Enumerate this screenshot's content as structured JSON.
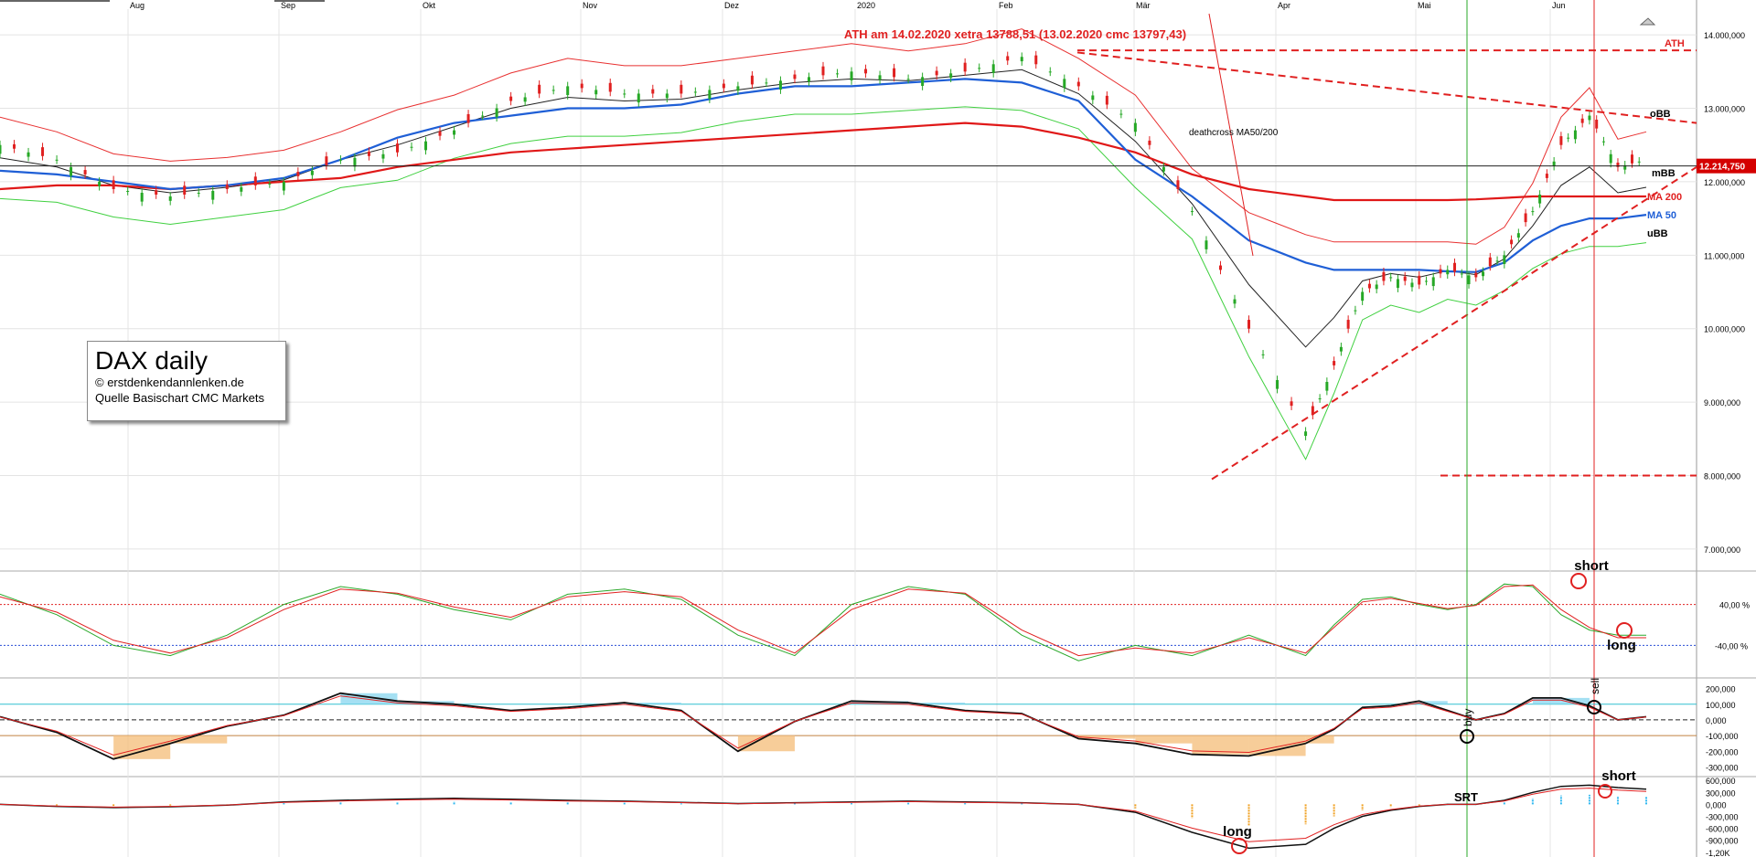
{
  "chart_data": {
    "type": "line",
    "title": "ATH am 14.02.2020 xetra 13788,51 (13.02.2020  cmc 13797,43)",
    "months": [
      "Aug",
      "Sep",
      "Okt",
      "Nov",
      "Dez",
      "2020",
      "Feb",
      "Mär",
      "Apr",
      "Mai",
      "Jun"
    ],
    "y_ticks": [
      "14.000,000",
      "13.000,000",
      "12.000,000",
      "11.000,000",
      "10.000,000",
      "9.000,000",
      "8.000,000",
      "7.000,000"
    ],
    "ylim": [
      6700,
      14350
    ],
    "current_price": "12.214,750",
    "price_x": [
      0,
      10,
      20,
      30,
      40,
      50,
      60,
      70,
      80,
      90,
      100,
      110,
      120,
      130,
      140,
      150,
      160,
      170,
      180,
      190,
      200,
      210,
      220,
      230,
      235,
      240,
      245,
      250,
      255,
      260,
      265,
      270,
      275,
      280,
      285,
      290
    ],
    "close": [
      12500,
      12300,
      11900,
      11800,
      11900,
      12000,
      12300,
      12400,
      12700,
      13100,
      13300,
      13200,
      13200,
      13300,
      13400,
      13500,
      13400,
      13500,
      13700,
      13300,
      12800,
      11600,
      10000,
      8600,
      9500,
      10500,
      10700,
      10600,
      10800,
      10700,
      11000,
      11600,
      12500,
      12900,
      12200,
      12300
    ],
    "ma50": [
      12150,
      12100,
      12000,
      11900,
      11950,
      12050,
      12300,
      12600,
      12800,
      12900,
      13000,
      13000,
      13050,
      13200,
      13300,
      13300,
      13350,
      13400,
      13350,
      13100,
      12300,
      11800,
      11200,
      10900,
      10800,
      10800,
      10800,
      10800,
      10780,
      10770,
      10900,
      11200,
      11400,
      11500,
      11500,
      11550
    ],
    "ma200": [
      11900,
      11950,
      11950,
      11900,
      11950,
      12000,
      12050,
      12200,
      12300,
      12400,
      12450,
      12500,
      12550,
      12600,
      12650,
      12700,
      12750,
      12800,
      12750,
      12600,
      12400,
      12100,
      11900,
      11800,
      11750,
      11750,
      11750,
      11750,
      11750,
      11760,
      11780,
      11800,
      11800,
      11800,
      11800,
      11800
    ],
    "ath_level": 13788.51,
    "low_level": 8000,
    "labels": {
      "ath": "ATH",
      "obb": "oBB",
      "mbb": "mBB",
      "ma200": "MA 200",
      "ma50": "MA 50",
      "ubb": "uBB",
      "deathcross": "deathcross MA50/200"
    },
    "stoch": {
      "ticks": [
        "40,00 %",
        "-40,00 %"
      ],
      "k": [
        60,
        20,
        -40,
        -60,
        -20,
        40,
        75,
        60,
        30,
        10,
        60,
        70,
        50,
        -20,
        -60,
        40,
        75,
        60,
        -20,
        -70,
        -40,
        -60,
        -20,
        -60,
        0,
        50,
        55,
        40,
        30,
        40,
        80,
        75,
        20,
        -10,
        -20,
        -20
      ],
      "d": [
        55,
        25,
        -30,
        -55,
        -25,
        30,
        70,
        62,
        35,
        15,
        55,
        65,
        55,
        -10,
        -55,
        30,
        70,
        62,
        -10,
        -60,
        -45,
        -55,
        -25,
        -55,
        -5,
        45,
        52,
        42,
        32,
        38,
        75,
        78,
        30,
        -5,
        -25,
        -25
      ]
    },
    "macd": {
      "ticks": [
        "200,000",
        "100,000",
        "0,000",
        "-100,000",
        "-200,000",
        "-300,000"
      ],
      "line": [
        20,
        -80,
        -250,
        -150,
        -40,
        30,
        170,
        120,
        100,
        60,
        80,
        110,
        60,
        -200,
        -10,
        120,
        110,
        60,
        40,
        -120,
        -150,
        -220,
        -230,
        -150,
        -60,
        80,
        90,
        120,
        60,
        0,
        40,
        140,
        140,
        90,
        0,
        20
      ]
    },
    "srt": {
      "ticks": [
        "600,000",
        "300,000",
        "0,000",
        "-300,000",
        "-600,000",
        "-900,000",
        "-1,20K"
      ],
      "line": [
        0,
        -50,
        -80,
        -60,
        -20,
        60,
        100,
        130,
        150,
        130,
        100,
        80,
        50,
        20,
        40,
        60,
        80,
        60,
        40,
        0,
        -200,
        -700,
        -1100,
        -1000,
        -600,
        -300,
        -150,
        -50,
        0,
        0,
        100,
        300,
        450,
        480,
        420,
        380
      ]
    },
    "annotations": {
      "short_top": "short",
      "long_mid": "long",
      "buy": "buy",
      "sell": "sell",
      "long_bottom": "long",
      "srt": "SRT",
      "short_bottom": "short"
    }
  },
  "legend": {
    "title": "DAX daily",
    "line1": "© erstdenkendannlenken.de",
    "line2": "Quelle Basischart CMC Markets"
  },
  "colors": {
    "price_up": "#26a826",
    "price_down": "#e02020",
    "ma50": "#1f5fd6",
    "ma200": "#e01818",
    "bb_upper": "#e83030",
    "bb_lower": "#40d040",
    "trend": "#e02020",
    "grid": "#e4e4e4"
  }
}
